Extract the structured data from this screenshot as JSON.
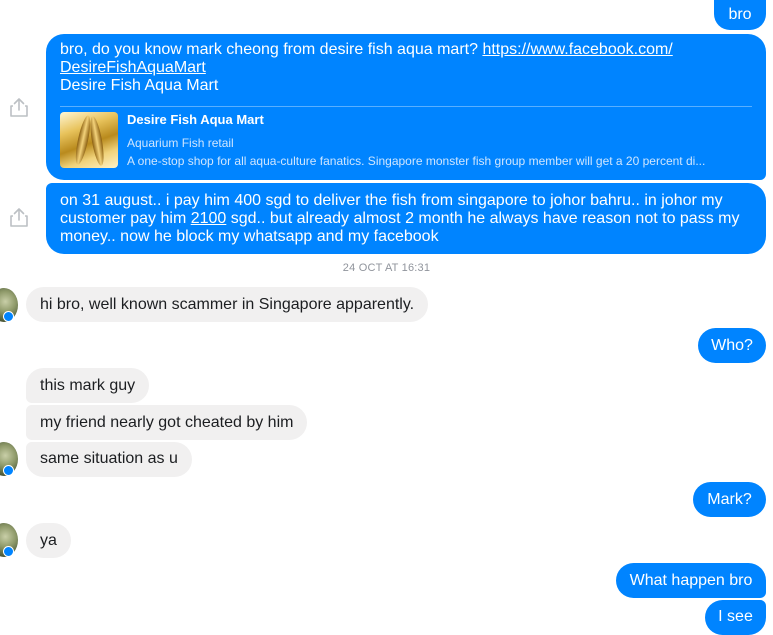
{
  "messages": {
    "m1": "bro",
    "m2_text": "bro, do you know mark cheong from desire fish aqua mart? ",
    "m2_link_line1": "https://www.facebook.com/",
    "m2_link_line2": "DesireFishAquaMart",
    "m2_line3": "Desire Fish Aqua Mart",
    "preview": {
      "title": "Desire Fish Aqua Mart",
      "subtitle": "Aquarium Fish retail",
      "description": "A one-stop shop for all aqua-culture fanatics. Singapore monster fish group member will get a 20 percent di..."
    },
    "m3_part1": "on 31 august.. i pay him 400 sgd to deliver the fish from singapore to johor bahru.. in johor my customer pay him ",
    "m3_amount": "2100",
    "m3_part2": " sgd.. but already almost 2 month he always have reason not to pass my money.. now he block my whatsapp and my facebook",
    "timestamp": "24 OCT AT 16:31",
    "r1": "hi bro, well known scammer in Singapore apparently.",
    "s1": "Who?",
    "r2": "this mark guy",
    "r3": "my friend nearly got cheated by him",
    "r4": "same situation as u",
    "s2": "Mark?",
    "r5": "ya",
    "s3": "What happen bro",
    "s4": "I see"
  },
  "colors": {
    "outgoing": "#0084ff",
    "incoming": "#f1f0f0",
    "timestamp": "#90949c"
  },
  "icons": [
    "share-icon",
    "contact-avatar",
    "messenger-badge-icon"
  ]
}
